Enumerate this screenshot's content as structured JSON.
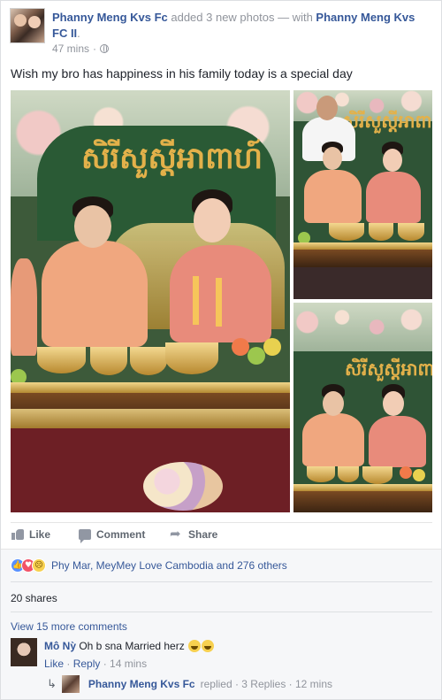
{
  "post": {
    "author": "Phanny Meng Kvs Fc",
    "action": " added 3 new photos — with ",
    "tagged": "Phanny Meng Kvs FC II",
    "tagged_suffix": ".",
    "time": "47 mins",
    "separator": "·",
    "privacy_icon": "globe-icon",
    "text": "Wish my bro has happiness in his family today is a special day"
  },
  "photos": {
    "banner_text": "សិរីសួស្តីអាពាហ៍",
    "count": 3
  },
  "actions": {
    "like": "Like",
    "comment": "Comment",
    "share": "Share"
  },
  "feedback": {
    "reaction_icons": [
      "like-icon",
      "love-icon",
      "sad-icon"
    ],
    "reactions_text": "Phy Mar, MeyMey Love Cambodia and 276 others",
    "shares": "20 shares",
    "view_more": "View 15 more comments"
  },
  "comment": {
    "author": "Mô Nỳ",
    "text": " Oh b sna Married herz",
    "like": "Like",
    "reply": "Reply",
    "time": "14 mins",
    "dot": " · "
  },
  "reply": {
    "author": "Phanny Meng Kvs Fc",
    "status": " replied · 3 Replies · 12 mins"
  },
  "colors": {
    "link": "#365899",
    "muted": "#90949c",
    "background": "#e9ebee"
  }
}
